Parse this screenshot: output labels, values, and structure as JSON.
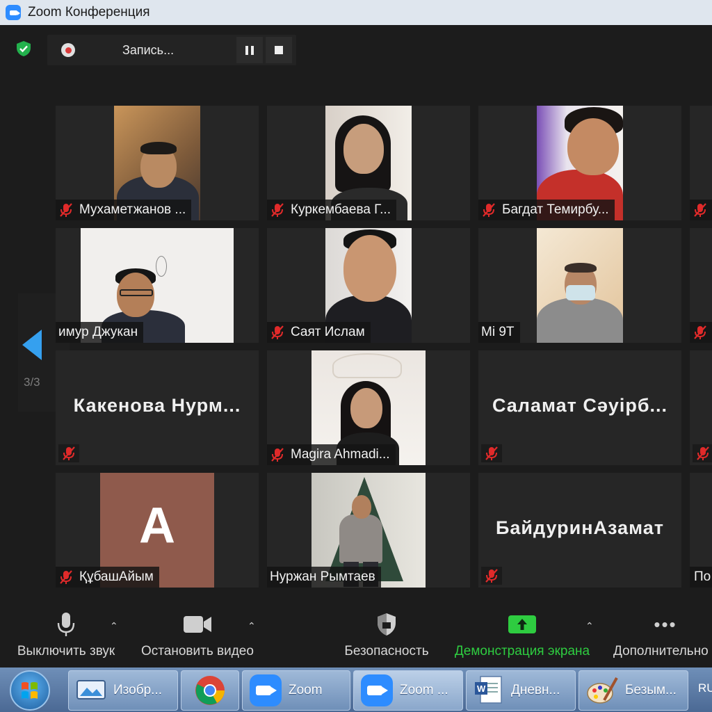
{
  "window": {
    "title": "Zoom Конференция"
  },
  "recording": {
    "text": "Запись..."
  },
  "navigation": {
    "page_indicator": "3/3"
  },
  "participants": [
    {
      "name": "Мухаметжанов ...",
      "muted": true
    },
    {
      "name": "Куркембаева Г...",
      "muted": true
    },
    {
      "name": "Багдат Темирбу...",
      "muted": true
    },
    {
      "name": "имур Джукан",
      "muted": false
    },
    {
      "name": "Саят Ислам",
      "muted": true
    },
    {
      "name": "Mi 9T",
      "muted": false
    },
    {
      "name": "Какенова Нурм...",
      "muted": true,
      "no_video": true
    },
    {
      "name": "Magira Ahmadi...",
      "muted": true
    },
    {
      "name": "Саламат Сәуірб...",
      "muted": true,
      "no_video": true
    },
    {
      "name": "ҚұбашАйым",
      "muted": true,
      "avatar_letter": "A",
      "avatar_color": "#8f5a4c"
    },
    {
      "name": "Нуржан Рымтаев",
      "muted": false
    },
    {
      "name": "БайдуринАзамат",
      "muted": true,
      "no_video": true
    },
    {
      "name": "По",
      "muted": false
    }
  ],
  "toolbar": {
    "mute_label": "Выключить звук",
    "video_label": "Остановить видео",
    "security_label": "Безопасность",
    "share_label": "Демонстрация экрана",
    "more_label": "Дополнительно",
    "share_color": "#2ecc40"
  },
  "taskbar": {
    "items": [
      {
        "label": "Изобр..."
      },
      {
        "label": ""
      },
      {
        "label": "Zoom"
      },
      {
        "label": "Zoom ..."
      },
      {
        "label": "Дневн..."
      },
      {
        "label": "Безым..."
      },
      {
        "label": "RU"
      }
    ]
  }
}
